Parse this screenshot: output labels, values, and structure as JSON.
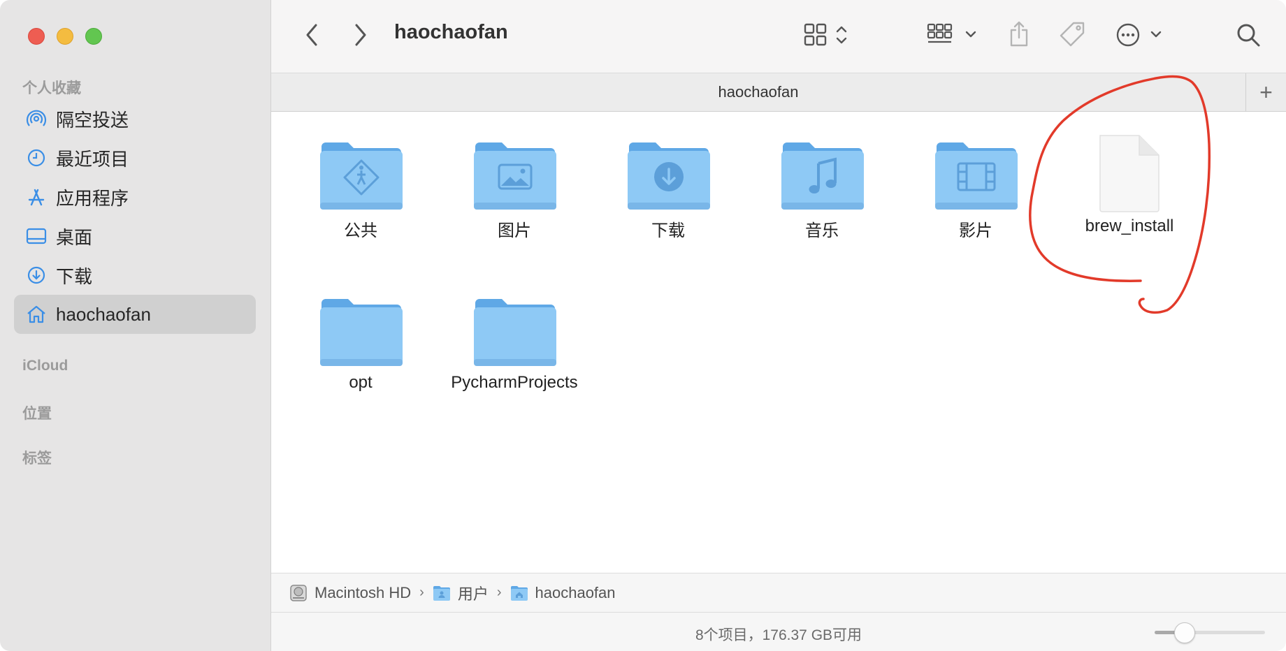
{
  "window": {
    "title": "haochaofan"
  },
  "sidebar": {
    "sections": {
      "favorites": "个人收藏",
      "icloud": "iCloud",
      "locations": "位置",
      "tags": "标签"
    },
    "items": [
      {
        "label": "隔空投送",
        "icon": "airdrop-icon"
      },
      {
        "label": "最近项目",
        "icon": "clock-icon"
      },
      {
        "label": "应用程序",
        "icon": "applications-icon"
      },
      {
        "label": "桌面",
        "icon": "desktop-icon"
      },
      {
        "label": "下载",
        "icon": "download-icon"
      },
      {
        "label": "haochaofan",
        "icon": "home-icon",
        "selected": true
      }
    ]
  },
  "toolbar": {
    "title": "haochaofan"
  },
  "tab": {
    "title": "haochaofan",
    "add_label": "+"
  },
  "content": {
    "items": [
      {
        "label": "公共",
        "kind": "folder",
        "glyph": "public-icon"
      },
      {
        "label": "图片",
        "kind": "folder",
        "glyph": "picture-icon"
      },
      {
        "label": "下载",
        "kind": "folder",
        "glyph": "download-icon"
      },
      {
        "label": "音乐",
        "kind": "folder",
        "glyph": "music-icon"
      },
      {
        "label": "影片",
        "kind": "folder",
        "glyph": "film-icon"
      },
      {
        "label": "brew_install",
        "kind": "file"
      },
      {
        "label": "opt",
        "kind": "folder"
      },
      {
        "label": "PycharmProjects",
        "kind": "folder"
      }
    ]
  },
  "pathbar": {
    "crumbs": [
      {
        "label": "Macintosh HD",
        "icon": "hard-drive-icon"
      },
      {
        "label": "用户",
        "icon": "users-folder-icon"
      },
      {
        "label": "haochaofan",
        "icon": "home-folder-icon"
      }
    ]
  },
  "statusbar": {
    "text": "8个项目，176.37 GB可用",
    "zoom_level": 0.22
  },
  "colors": {
    "folder": "#8ec9f5",
    "folder_tab": "#5fa8e6",
    "annotation": "#e23a2a",
    "accent": "#3a8ee6"
  }
}
